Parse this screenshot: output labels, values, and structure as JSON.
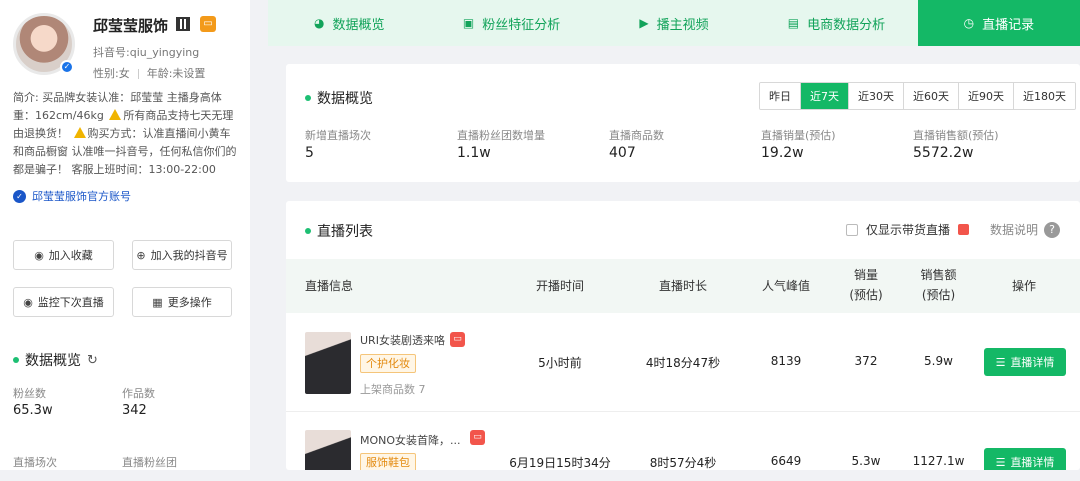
{
  "profile": {
    "name": "邱莹莹服饰",
    "douyin_id": "抖音号:qiu_yingying",
    "gender": "性别:女",
    "age": "年龄:未设置",
    "bio_1": "简介: 买品牌女装认准：邱莹莹 主播身高体重：162cm/46kg",
    "bio_2": "所有商品支持七天无理由退换货！",
    "bio_3": "购买方式：认准直播间小黄车和商品橱窗 认准唯一抖音号，任何私信你们的都是骗子！ 客服上班时间：13:00-22:00",
    "official_account": "邱莹莹服饰官方账号"
  },
  "actions": {
    "favorite": "加入收藏",
    "add_mine": "加入我的抖音号",
    "monitor": "监控下次直播",
    "more": "更多操作"
  },
  "left_stats": {
    "title": "数据概览",
    "fans_label": "粉丝数",
    "fans_value": "65.3w",
    "works_label": "作品数",
    "works_value": "342",
    "live_sessions_label": "直播场次",
    "fan_group_label": "直播粉丝团"
  },
  "tabs": [
    {
      "label": "数据概览",
      "icon": "pie-chart-icon"
    },
    {
      "label": "粉丝特征分析",
      "icon": "user-card-icon"
    },
    {
      "label": "播主视频",
      "icon": "video-camera-icon"
    },
    {
      "label": "电商数据分析",
      "icon": "shop-icon"
    },
    {
      "label": "直播记录",
      "icon": "clock-icon"
    }
  ],
  "overview": {
    "title": "数据概览",
    "ranges": [
      "昨日",
      "近7天",
      "近30天",
      "近60天",
      "近90天",
      "近180天"
    ],
    "active_range": "近7天",
    "metrics": [
      {
        "label": "新增直播场次",
        "value": "5"
      },
      {
        "label": "直播粉丝团数增量",
        "value": "1.1w"
      },
      {
        "label": "直播商品数",
        "value": "407"
      },
      {
        "label": "直播销量(预估)",
        "value": "19.2w"
      },
      {
        "label": "直播销售额(预估)",
        "value": "5572.2w"
      }
    ]
  },
  "live_list": {
    "title": "直播列表",
    "filter_label": "仅显示带货直播",
    "help_label": "数据说明",
    "columns": {
      "info": "直播信息",
      "start": "开播时间",
      "duration": "直播时长",
      "peak": "人气峰值",
      "sales_1": "销量",
      "sales_2": "(预估)",
      "revenue_1": "销售额",
      "revenue_2": "(预估)",
      "ops": "操作"
    },
    "rows": [
      {
        "title": "URI女装剧透来咯",
        "tag": "个护化妆",
        "goods": "上架商品数 7",
        "start": "5小时前",
        "duration": "4时18分47秒",
        "peak": "8139",
        "sales": "372",
        "revenue": "5.9w",
        "button": "直播详情"
      },
      {
        "title": "MONO女装首降，...",
        "tag": "服饰鞋包",
        "goods": "",
        "start": "6月19日15时34分",
        "duration": "8时57分4秒",
        "peak": "6649",
        "sales": "5.3w",
        "revenue": "1127.1w",
        "button": "直播详情"
      }
    ]
  },
  "colors": {
    "accent": "#14b866",
    "tab_bg": "#e6f7ee",
    "link": "#1a56c8",
    "tag_orange": "#e38a0f"
  }
}
